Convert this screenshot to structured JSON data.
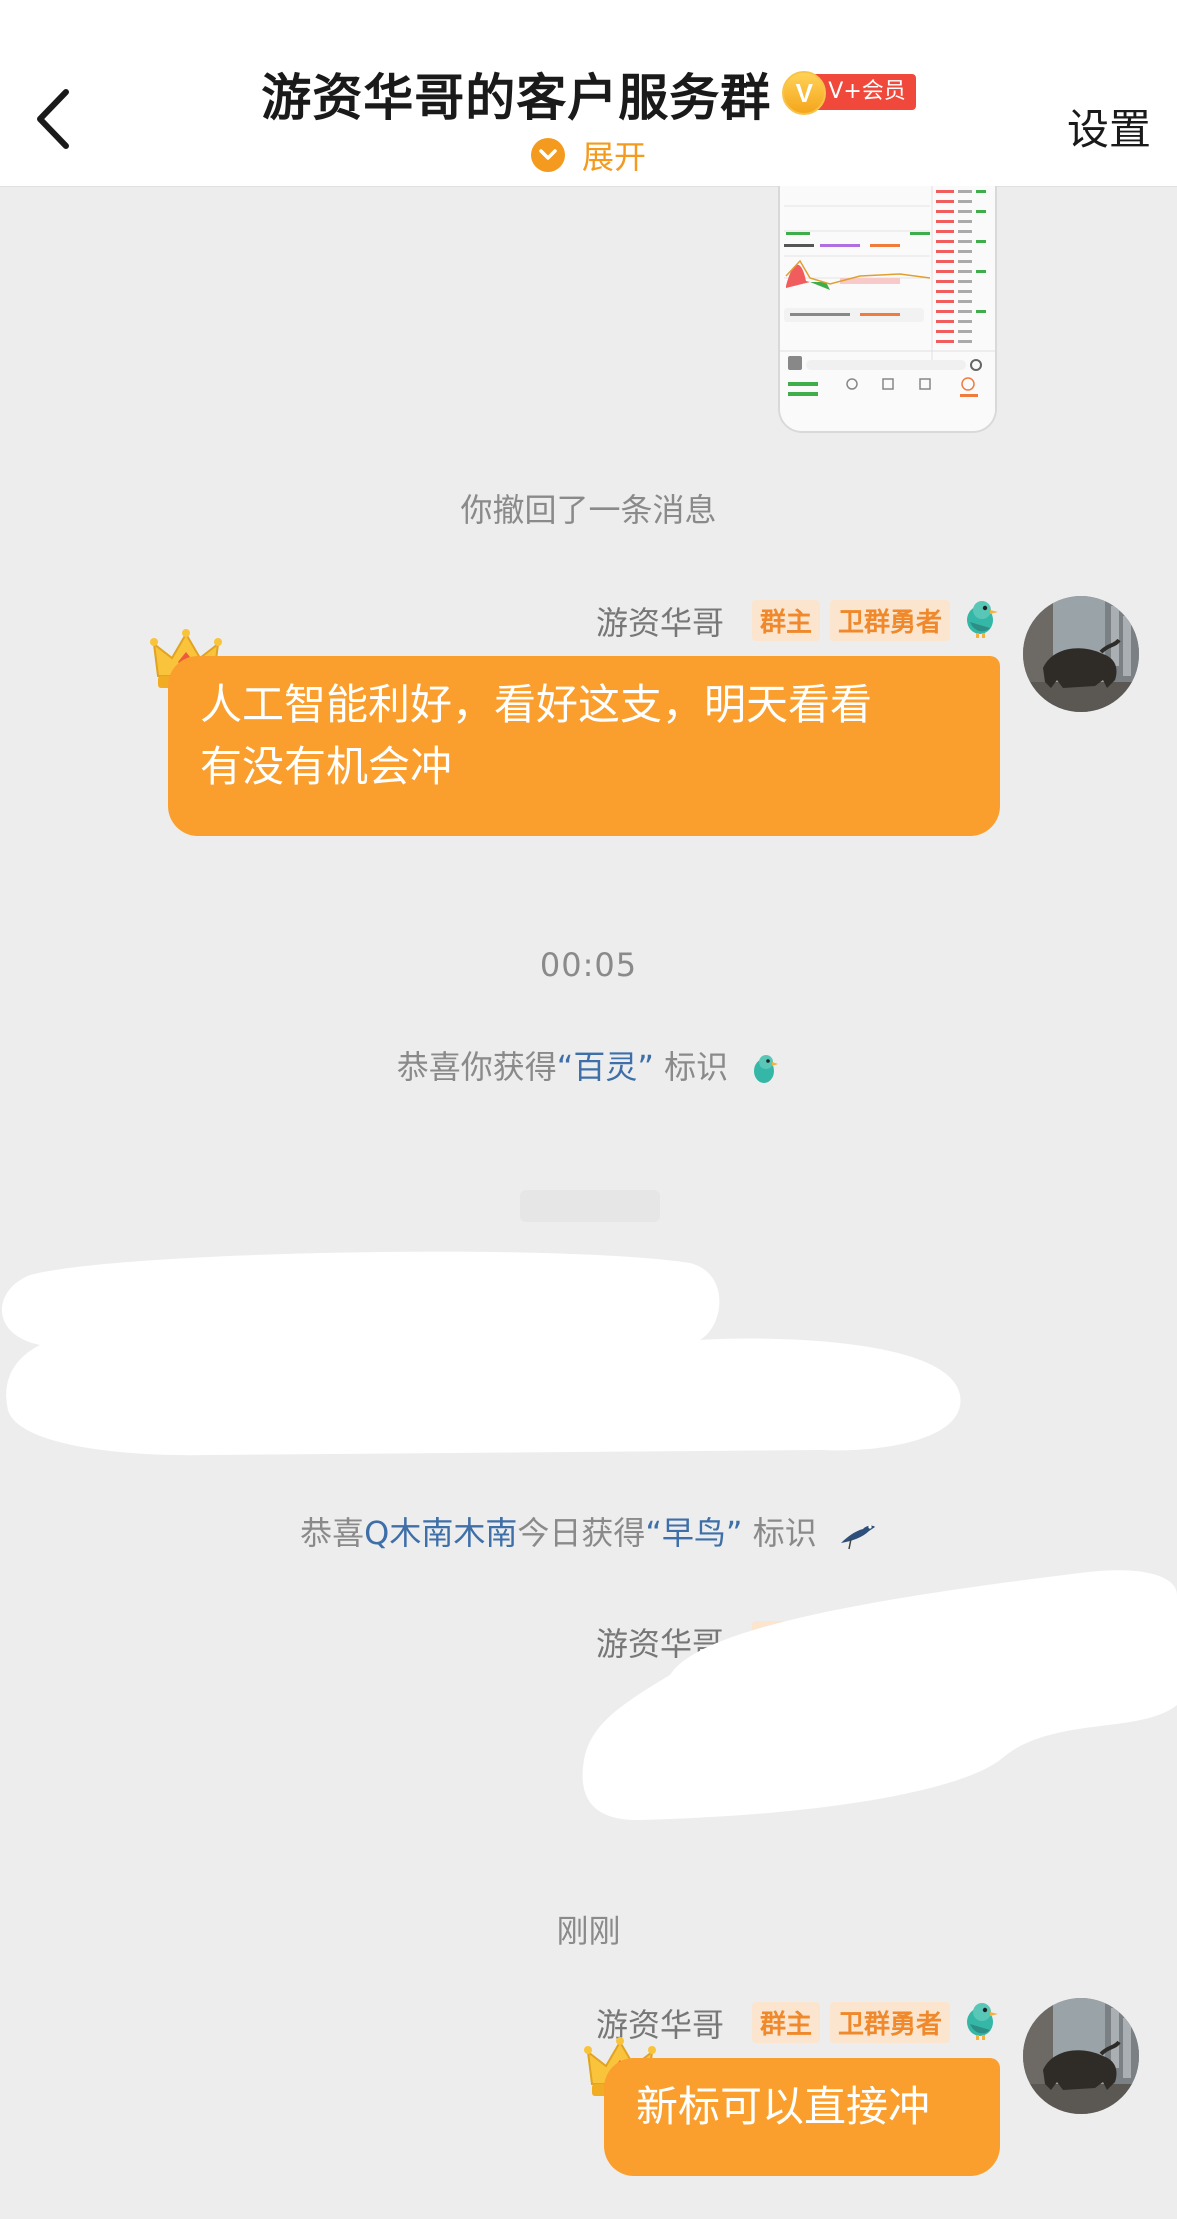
{
  "header": {
    "title": "游资华哥的客户服务群",
    "vip_letter": "V",
    "vip_label": "V+会员",
    "expand_label": "展开",
    "settings_label": "设置"
  },
  "messages": {
    "recall_notice": "你撤回了一条消息",
    "msg1": {
      "sender": "游资华哥",
      "tag_owner": "群主",
      "tag_guard": "卫群勇者",
      "text_line1": "人工智能利好，看好这支，明天看看",
      "text_line2": "有没有机会冲"
    },
    "time1": "00:05",
    "badge_notice": {
      "prefix": "恭喜你获得",
      "name": "“百灵”",
      "suffix": "标识"
    },
    "early_bird_notice": {
      "prefix": "恭喜",
      "user": "Q木南木南",
      "middle": "今日获得",
      "name": "“早鸟”",
      "suffix": "标识"
    },
    "msg2": {
      "sender": "游资华哥",
      "tag_owner": "群主"
    },
    "time2": "刚刚",
    "msg3": {
      "sender": "游资华哥",
      "tag_owner": "群主",
      "tag_guard": "卫群勇者",
      "text": "新标可以直接冲"
    }
  },
  "colors": {
    "bubble": "#fa9f2e",
    "accent_orange": "#f39a1f",
    "link_blue": "#3e6fa8",
    "vip_red": "#f0483a"
  }
}
